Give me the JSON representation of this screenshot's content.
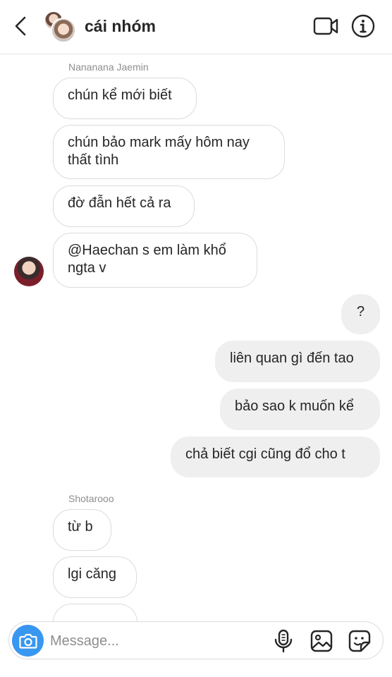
{
  "header": {
    "title": "cái nhóm",
    "icons": {
      "back": "chevron-left-icon",
      "video": "video-camera-icon",
      "info": "info-icon"
    }
  },
  "messages": [
    {
      "sender": "Nananana Jaemin",
      "side": "in",
      "text": "chún kể mới biết"
    },
    {
      "side": "in",
      "text": "chún bảo mark mấy hôm nay thất tình"
    },
    {
      "side": "in",
      "text": "đờ đẫn hết cả ra"
    },
    {
      "side": "in",
      "text": "@Haechan s em làm khổ ngta v"
    },
    {
      "side": "out",
      "text": "?"
    },
    {
      "side": "out",
      "text": "liên quan gì đến tao"
    },
    {
      "side": "out",
      "text": "bảo sao k muốn kể"
    },
    {
      "side": "out",
      "text": "chả biết cgi cũng đổ cho t"
    },
    {
      "sender": "Shotarooo",
      "side": "in",
      "text": "từ b"
    },
    {
      "side": "in",
      "text": "lgi căng"
    }
  ],
  "composer": {
    "placeholder": "Message...",
    "icons": {
      "camera": "camera-icon",
      "mic": "microphone-icon",
      "gallery": "gallery-icon",
      "sticker": "sticker-icon"
    }
  },
  "colors": {
    "accent": "#3897f0",
    "outgoing_bubble": "#efefef",
    "incoming_border": "#dbdbdb"
  }
}
